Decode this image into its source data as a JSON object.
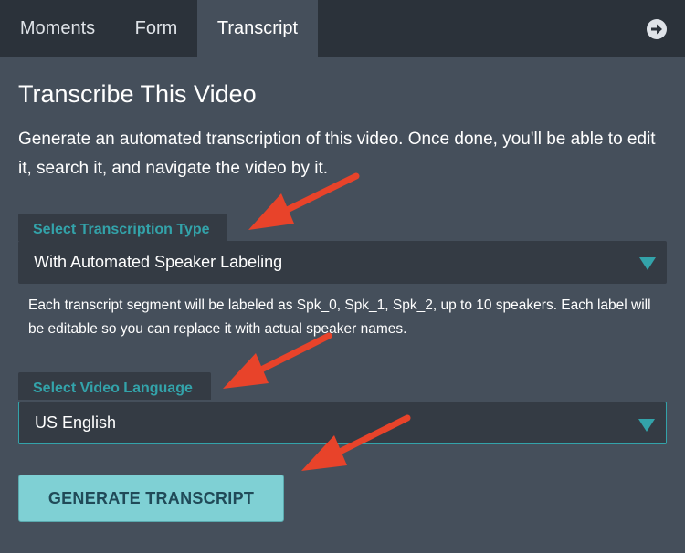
{
  "tabs": [
    {
      "label": "Moments",
      "active": false
    },
    {
      "label": "Form",
      "active": false
    },
    {
      "label": "Transcript",
      "active": true
    }
  ],
  "header": {
    "next_icon": "arrow-right-circle-icon"
  },
  "main": {
    "title": "Transcribe This Video",
    "description": "Generate an automated transcription of this video. Once done, you'll be able to edit it, search it, and navigate the video by it.",
    "transcription_type": {
      "label": "Select Transcription Type",
      "selected": "With Automated Speaker Labeling",
      "help": "Each transcript segment will be labeled as Spk_0, Spk_1, Spk_2, up to 10 speakers. Each label will be editable so you can replace it with actual speaker names."
    },
    "video_language": {
      "label": "Select Video Language",
      "selected": "US English"
    },
    "generate_label": "GENERATE TRANSCRIPT"
  },
  "colors": {
    "background": "#454f5b",
    "tabbar": "#2b323a",
    "field": "#343b44",
    "accent": "#33a3aa",
    "button": "#7fd0d4",
    "annotation_arrow": "#e8432a"
  }
}
